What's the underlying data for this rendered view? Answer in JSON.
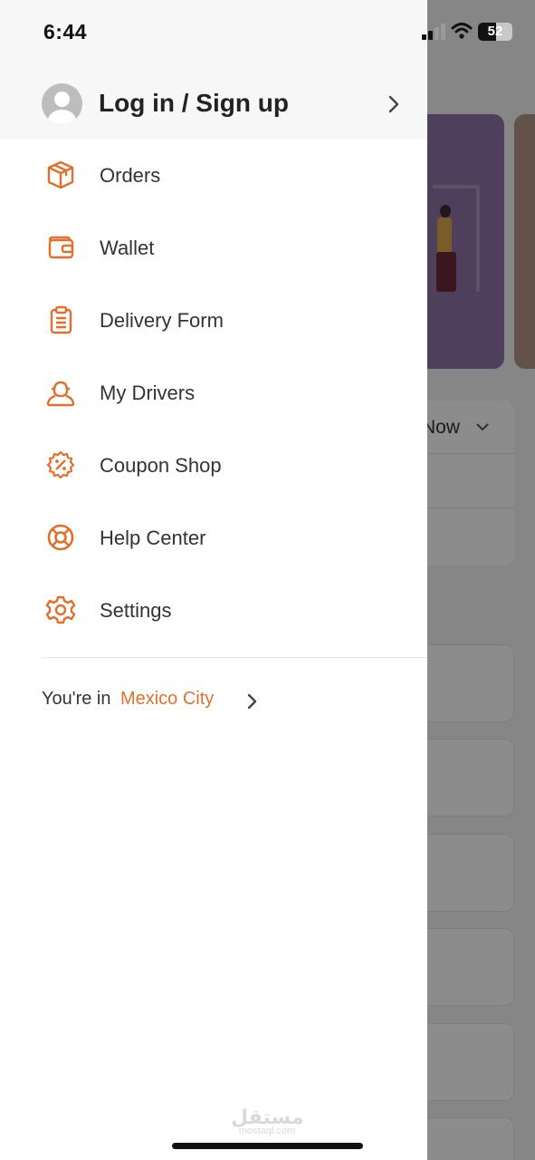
{
  "status_bar": {
    "time": "6:44",
    "battery": "52",
    "battery_level": 0.52
  },
  "drawer": {
    "login_label": "Log in / Sign up",
    "menu": [
      {
        "label": "Orders",
        "icon": "box-icon"
      },
      {
        "label": "Wallet",
        "icon": "wallet-icon"
      },
      {
        "label": "Delivery Form",
        "icon": "clipboard-icon"
      },
      {
        "label": "My Drivers",
        "icon": "drivers-icon"
      },
      {
        "label": "Coupon Shop",
        "icon": "coupon-icon"
      },
      {
        "label": "Help Center",
        "icon": "lifebuoy-icon"
      },
      {
        "label": "Settings",
        "icon": "gear-icon"
      }
    ],
    "location_prefix": "You're in",
    "location_city": "Mexico City"
  },
  "background": {
    "order_type": "Now"
  },
  "watermark": {
    "arabic": "مستقل",
    "latin": "mostaql.com"
  },
  "colors": {
    "accent": "#E1702C",
    "text": "#333333",
    "scrim": "rgba(0,0,0,0.45)"
  }
}
